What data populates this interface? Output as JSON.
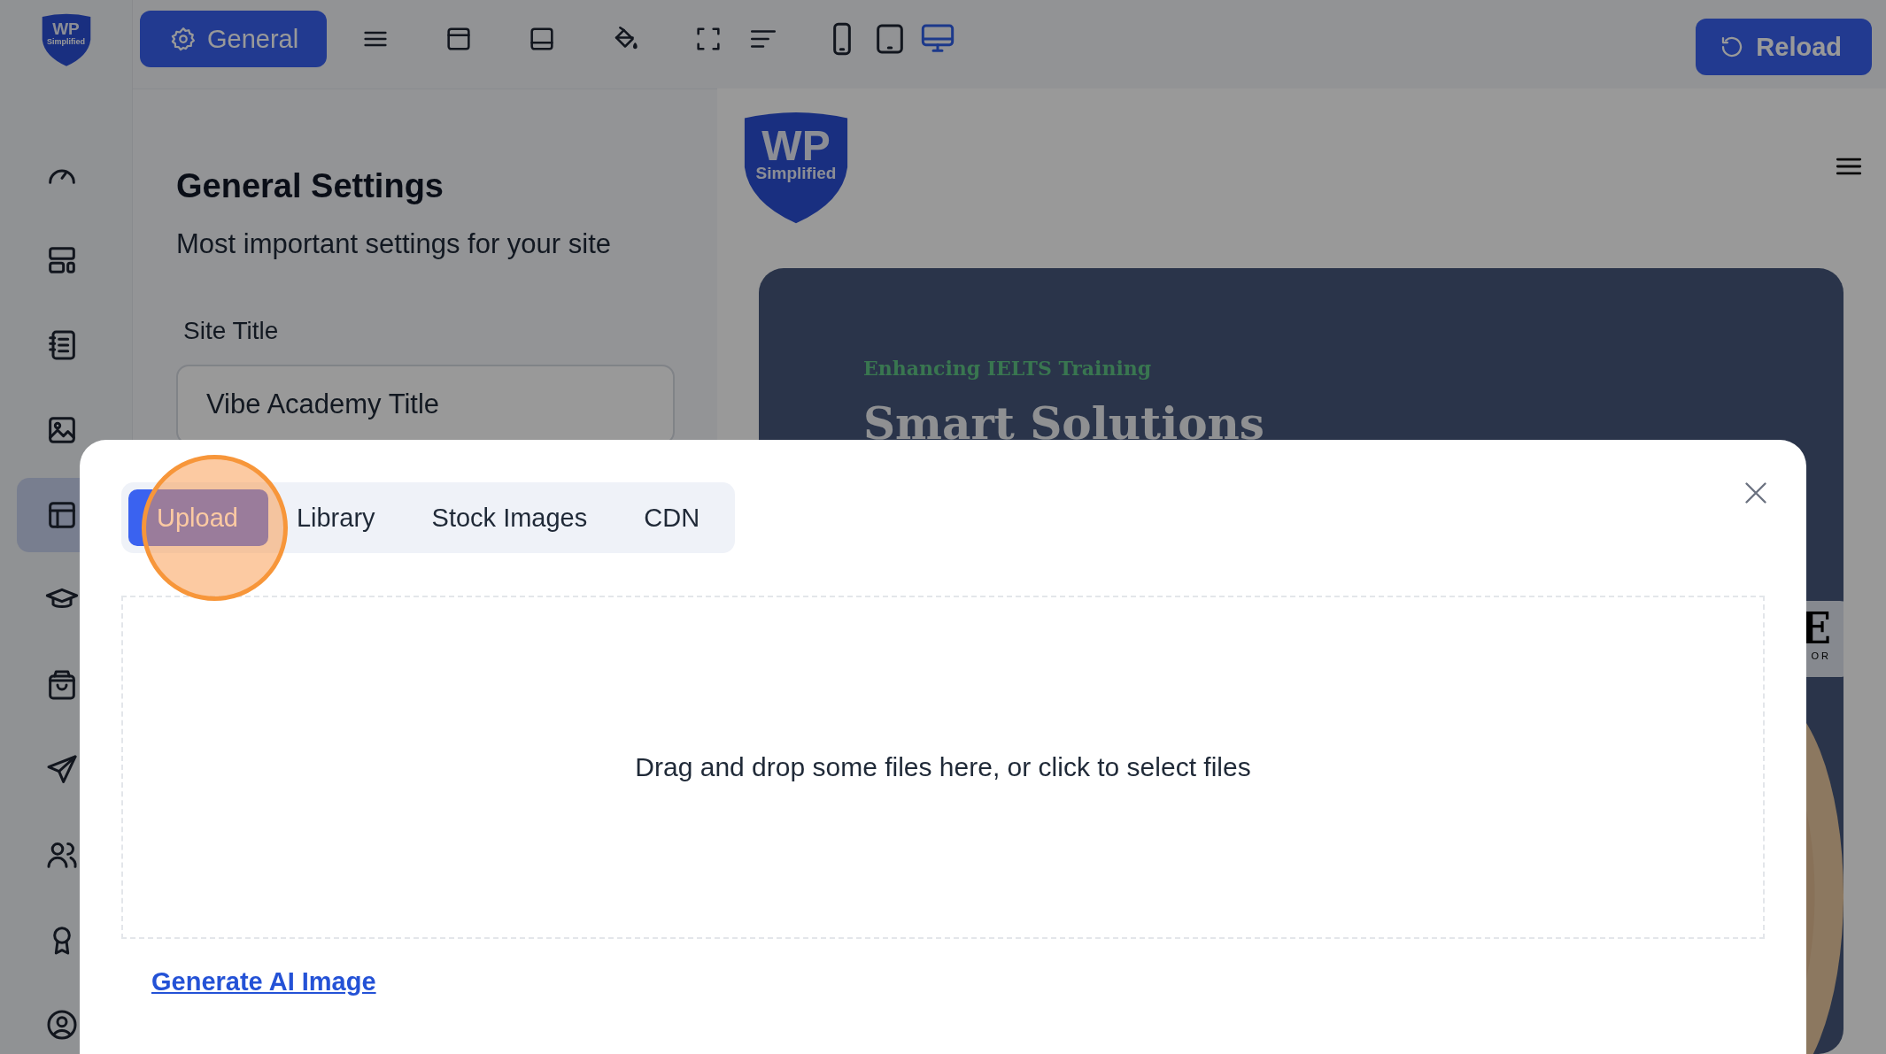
{
  "sidebar": {
    "logo": {
      "line_1": "WP",
      "line_2": "Simplified"
    },
    "nav_items": [
      {
        "selected": false
      },
      {
        "selected": false
      },
      {
        "selected": false
      },
      {
        "selected": false
      },
      {
        "selected": true
      },
      {
        "selected": false
      },
      {
        "selected": false
      },
      {
        "selected": false
      },
      {
        "selected": false
      },
      {
        "selected": false
      },
      {
        "selected": false
      }
    ]
  },
  "toolbar": {
    "general_button": "General",
    "devices": [
      {
        "selected": false
      },
      {
        "selected": false
      },
      {
        "selected": true
      }
    ],
    "reload_button": "Reload"
  },
  "settings": {
    "title": "General Settings",
    "subtitle": "Most important settings for your site",
    "field": {
      "label": "Site Title",
      "value": "Vibe Academy Title"
    }
  },
  "preview": {
    "logo": {
      "line_1": "WP",
      "line_2": "Simplified"
    },
    "hero": {
      "eyebrow": "Enhancing IELTS Training",
      "heading": "Smart Solutions"
    },
    "badge": {
      "line_1": "E",
      "line_2": "OR"
    }
  },
  "modal": {
    "tabs": [
      {
        "label": "Upload",
        "selected": true
      },
      {
        "label": "Library",
        "selected": false
      },
      {
        "label": "Stock Images",
        "selected": false
      },
      {
        "label": "CDN",
        "selected": false
      }
    ],
    "dropzone_text": "Drag and drop some files here, or click to select files",
    "link": "Generate AI Image"
  }
}
